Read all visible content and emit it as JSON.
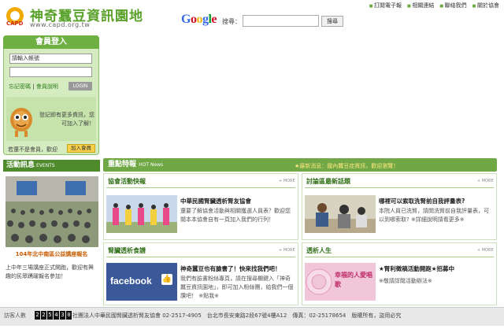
{
  "header": {
    "logo_letters": "CAPD",
    "site_title": "神奇蠶豆資訊園地",
    "site_url": "www.capd.org.tw",
    "google_brand": "Google",
    "search_label": "搜尋：",
    "search_value": "",
    "search_button": "搜尋",
    "top_links": [
      "訂閱電子報",
      "相關連結",
      "聯絡我們",
      "關於協會"
    ]
  },
  "login": {
    "title": "會員登入",
    "account_placeholder": "請輸入帳號",
    "forgot": "忘記密碼",
    "member_notice": "會員說明",
    "login_button": "LOGIN",
    "mascot_text": "登記即有更多資訊，您可加入了解！",
    "join_text": "若還不是會員，歡迎",
    "join_button": "加入會員"
  },
  "activity": {
    "title": "活動訊息",
    "title_en": "EVENTS",
    "caption": "104年北中南區公益講座報名",
    "text": "上中年三場講座正式開跑，歡迎有興趣的民眾踴躍報名參加！"
  },
  "news": {
    "title": "重點特報",
    "title_en": "HOT News",
    "alert": "★最新消息：國內蠶豆症資訊，歡迎瀏覽！",
    "more": "+ MORE",
    "panels": [
      {
        "title": "協會活動快報",
        "headline": "中華民國腎臟透析腎友協會",
        "desc": "還要了解協會活動與相關獲選人員表？歡迎您閱本本協會自有一頁加入我們的行列！"
      },
      {
        "title": "討論區最新話題",
        "headline": "哪裡可以索取洗腎前自我評量表?",
        "desc": "本院人員已洗腎，請問洗腎前自我評量表，可以到哪索取? ※詳細說明請看更多※"
      },
      {
        "title": "腎臟透析食譜",
        "headline": "神奇蠶豆也有臉書了！快來找我們吧！",
        "facebook_label": "facebook",
        "desc": "我們有臉書粉絲專頁，請在搜尋欄鍵入「神奇蠶豆資訊園地」，即可加入粉絲團，給我們一個讚吧！ ※點我※"
      },
      {
        "title": "透析人生",
        "headline": "★腎利徵稿活動開跑★招募中",
        "image_text": "幸福的人愛唱歌",
        "desc": "※敬請詳閱活動辦法※"
      }
    ]
  },
  "footer": {
    "visit_label": "訪客人數",
    "counter": [
      "2",
      "2",
      "5",
      "4",
      "3",
      "0"
    ],
    "text": "社團法人中華民國腎臟透析腎友協會 02-2517-4905　台北市長安東路2段67號4樓A12　傳真：02-25178654　版權所有，盜用必究"
  },
  "colors": {
    "brand_green": "#5aa22b",
    "panel_green": "#6fb043",
    "accent_yellow": "#f7d14a"
  }
}
